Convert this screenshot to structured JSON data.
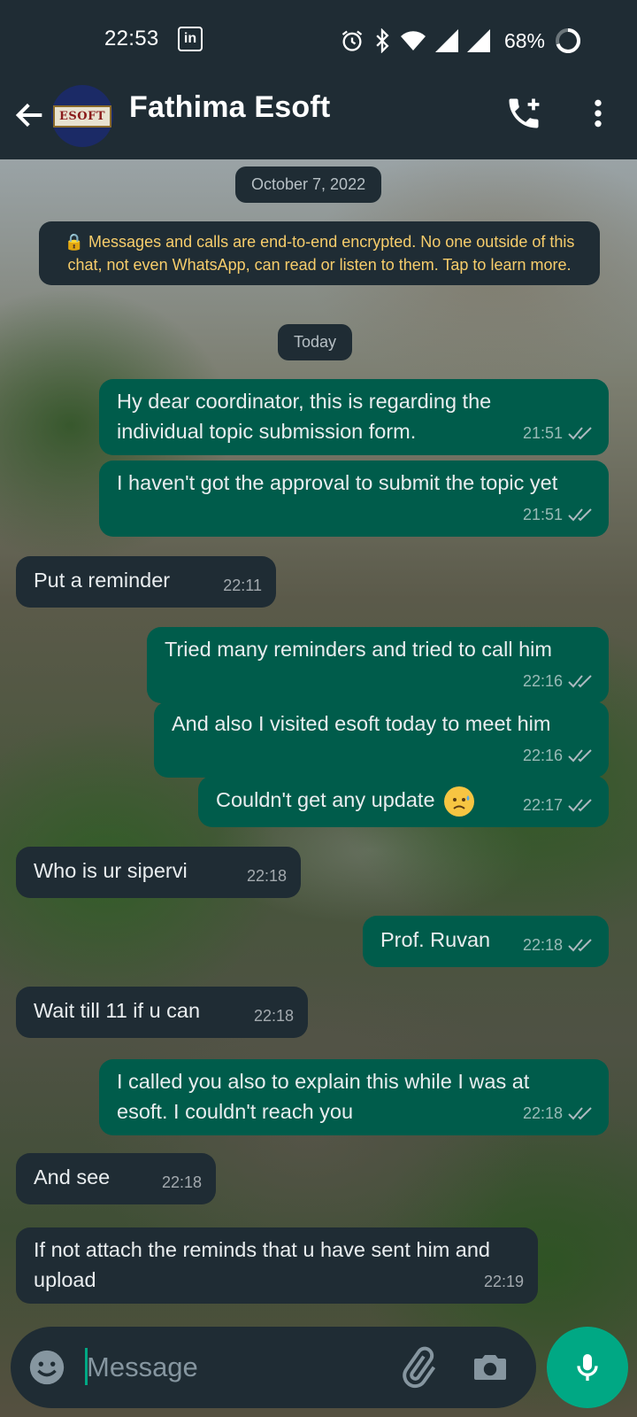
{
  "status_bar": {
    "time": "22:53",
    "linkedin_badge": "in",
    "battery": "68%",
    "icons": [
      "alarm-icon",
      "bluetooth-icon",
      "wifi-icon",
      "signal-icon",
      "signal-icon",
      "battery-ring-icon"
    ]
  },
  "header": {
    "contact_name": "Fathima Esoft",
    "avatar_text": "ESOFT",
    "icons": [
      "back-arrow-icon",
      "add-call-icon",
      "more-vert-icon"
    ]
  },
  "chat": {
    "date_chip": "October 7, 2022",
    "encryption_notice": "🔒 Messages and calls are end-to-end encrypted. No one outside of this chat, not even WhatsApp, can read or listen to them. Tap to learn more.",
    "today_chip": "Today",
    "messages": [
      {
        "dir": "out",
        "text": "Hy dear coordinator, this is regarding the individual topic submission form.",
        "time": "21:51"
      },
      {
        "dir": "out",
        "text": "I haven't got the approval to submit the topic yet",
        "time": "21:51"
      },
      {
        "dir": "in",
        "text": "Put a reminder",
        "time": "22:11"
      },
      {
        "dir": "out",
        "text": "Tried many reminders and tried to call him",
        "time": "22:16"
      },
      {
        "dir": "out",
        "text": "And also I visited esoft today to meet him",
        "time": "22:16"
      },
      {
        "dir": "out",
        "text": "Couldn't get any update",
        "emoji": "sad-sweat-face-emoji",
        "time": "22:17"
      },
      {
        "dir": "in",
        "text": "Who is ur sipervi",
        "time": "22:18"
      },
      {
        "dir": "out",
        "text": "Prof. Ruvan",
        "time": "22:18"
      },
      {
        "dir": "in",
        "text": "Wait till 11 if u can",
        "time": "22:18"
      },
      {
        "dir": "out",
        "text": "I called you also to explain this while I was at esoft. I couldn't reach you",
        "time": "22:18"
      },
      {
        "dir": "in",
        "text": "And see",
        "time": "22:18"
      },
      {
        "dir": "in",
        "text": "If not attach the reminds that u have sent him and upload",
        "time": "22:19"
      }
    ]
  },
  "input": {
    "placeholder": "Message",
    "icons": [
      "emoji-icon",
      "attach-icon",
      "camera-icon",
      "mic-icon"
    ]
  },
  "colors": {
    "bar_bg": "#1f2c34",
    "outgoing_bubble": "#005c4b",
    "incoming_bubble": "#1f2c34",
    "accent": "#00a884",
    "encryption_text": "#f7cd6b"
  }
}
